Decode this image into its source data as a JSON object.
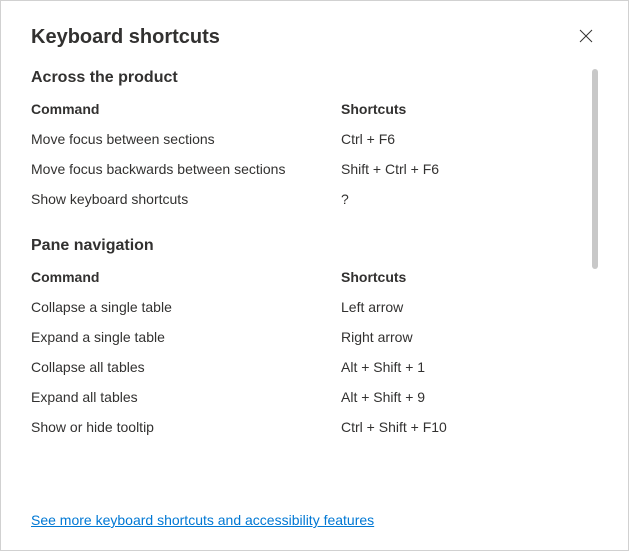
{
  "dialog": {
    "title": "Keyboard shortcuts",
    "footerLink": "See more keyboard shortcuts and accessibility features"
  },
  "sections": [
    {
      "title": "Across the product",
      "headers": {
        "command": "Command",
        "shortcut": "Shortcuts"
      },
      "rows": [
        {
          "command": "Move focus between sections",
          "shortcut": "Ctrl + F6"
        },
        {
          "command": "Move focus backwards between sections",
          "shortcut": "Shift + Ctrl + F6"
        },
        {
          "command": "Show keyboard shortcuts",
          "shortcut": "?"
        }
      ]
    },
    {
      "title": "Pane navigation",
      "headers": {
        "command": "Command",
        "shortcut": "Shortcuts"
      },
      "rows": [
        {
          "command": "Collapse a single table",
          "shortcut": "Left arrow"
        },
        {
          "command": "Expand a single table",
          "shortcut": "Right arrow"
        },
        {
          "command": "Collapse all tables",
          "shortcut": "Alt + Shift + 1"
        },
        {
          "command": "Expand all tables",
          "shortcut": "Alt + Shift + 9"
        },
        {
          "command": "Show or hide tooltip",
          "shortcut": "Ctrl + Shift + F10"
        }
      ]
    }
  ]
}
